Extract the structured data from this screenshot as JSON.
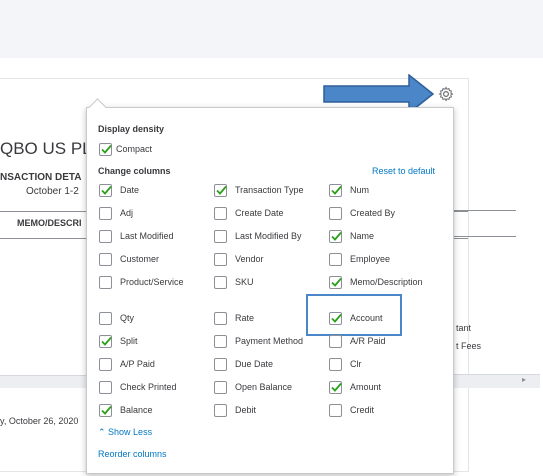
{
  "background": {
    "title": "QBO US PLU",
    "subtitle": "NSACTION DETA",
    "date": "October 1-2",
    "column_memo": "MEMO/DESCRI",
    "footer": "y, October 26, 2020",
    "right_text_1": "tant",
    "right_text_2": "t Fees",
    "scroll_arrow": "▸"
  },
  "panel": {
    "display_density_label": "Display density",
    "compact_label": "Compact",
    "change_columns_label": "Change columns",
    "reset_label": "Reset to default",
    "show_less_label": "⌃ Show Less",
    "reorder_label": "Reorder columns",
    "columns": [
      {
        "label": "Date",
        "checked": true
      },
      {
        "label": "Transaction Type",
        "checked": true
      },
      {
        "label": "Num",
        "checked": true
      },
      {
        "label": "Adj",
        "checked": false
      },
      {
        "label": "Create Date",
        "checked": false
      },
      {
        "label": "Created By",
        "checked": false
      },
      {
        "label": "Last Modified",
        "checked": false
      },
      {
        "label": "Last Modified By",
        "checked": false
      },
      {
        "label": "Name",
        "checked": true
      },
      {
        "label": "Customer",
        "checked": false
      },
      {
        "label": "Vendor",
        "checked": false
      },
      {
        "label": "Employee",
        "checked": false
      },
      {
        "label": "Product/Service",
        "checked": false
      },
      {
        "label": "SKU",
        "checked": false
      },
      {
        "label": "Memo/Description",
        "checked": true
      },
      {
        "label": "Qty",
        "checked": false
      },
      {
        "label": "Rate",
        "checked": false
      },
      {
        "label": "Account",
        "checked": true
      },
      {
        "label": "Split",
        "checked": true
      },
      {
        "label": "Payment Method",
        "checked": false
      },
      {
        "label": "A/R Paid",
        "checked": false
      },
      {
        "label": "A/P Paid",
        "checked": false
      },
      {
        "label": "Due Date",
        "checked": false
      },
      {
        "label": "Clr",
        "checked": false
      },
      {
        "label": "Check Printed",
        "checked": false
      },
      {
        "label": "Open Balance",
        "checked": false
      },
      {
        "label": "Amount",
        "checked": true
      },
      {
        "label": "Balance",
        "checked": true
      },
      {
        "label": "Debit",
        "checked": false
      },
      {
        "label": "Credit",
        "checked": false
      }
    ]
  },
  "colors": {
    "check": "#2ca01c",
    "link": "#0077c5",
    "arrow": "#4a86c8"
  }
}
